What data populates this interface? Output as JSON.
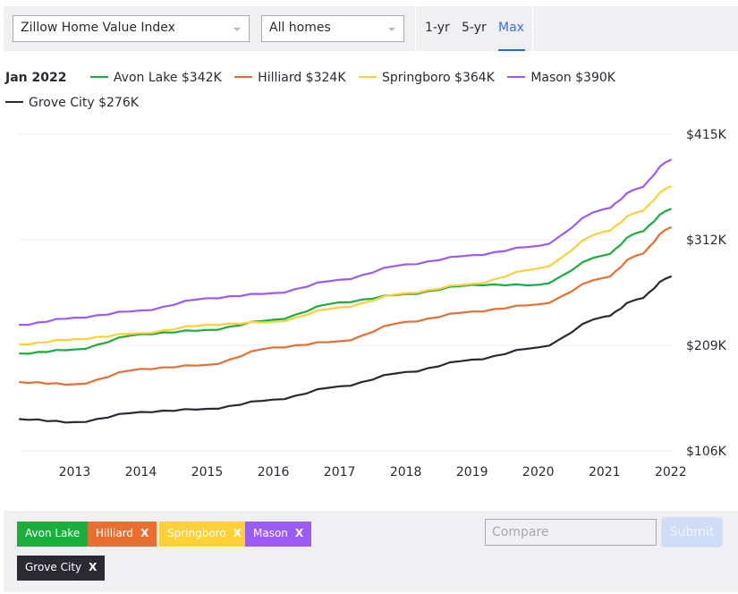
{
  "toolbar": {
    "metric_select": "Zillow Home Value Index",
    "home_type_select": "All homes",
    "ranges": [
      "1-yr",
      "5-yr",
      "Max"
    ],
    "active_range": "Max"
  },
  "legend": {
    "date": "Jan 2022",
    "items": [
      {
        "label": "Avon Lake $342K",
        "color": "#1aae3c"
      },
      {
        "label": "Hilliard $324K",
        "color": "#e86f30"
      },
      {
        "label": "Springboro $364K",
        "color": "#fdd038"
      },
      {
        "label": "Mason $390K",
        "color": "#9b5cf5"
      },
      {
        "label": "Grove City $276K",
        "color": "#2a2a33"
      }
    ]
  },
  "chips": [
    {
      "label": "Avon Lake",
      "removable": false,
      "color": "#1aae3c",
      "text_color": "#ffffff"
    },
    {
      "label": "Hilliard",
      "removable": true,
      "color": "#e86f30",
      "text_color": "#ffffff"
    },
    {
      "label": "Springboro",
      "removable": true,
      "color": "#fdd038",
      "text_color": "#ffffff"
    },
    {
      "label": "Mason",
      "removable": true,
      "color": "#9b5cf5",
      "text_color": "#ffffff"
    },
    {
      "label": "Grove City",
      "removable": true,
      "color": "#2a2a33",
      "text_color": "#ffffff"
    }
  ],
  "chip_remove_label": "X",
  "compare": {
    "placeholder": "Compare",
    "value": ""
  },
  "submit_label": "Submit",
  "chart_data": {
    "type": "line",
    "title": "",
    "xlabel": "",
    "ylabel": "",
    "x_ticks": [
      "2013",
      "2014",
      "2015",
      "2016",
      "2017",
      "2018",
      "2019",
      "2020",
      "2021",
      "2022"
    ],
    "y_ticks": [
      "$106K",
      "$209K",
      "$312K",
      "$415K"
    ],
    "y_tick_values": [
      106,
      209,
      312,
      415
    ],
    "xlim": [
      2012.17,
      2022.07
    ],
    "ylim": [
      106,
      415
    ],
    "grid": true,
    "y_axis_side": "right",
    "units": "thousand USD",
    "x": [
      2012.17,
      2013.0,
      2014.0,
      2015.0,
      2016.0,
      2017.0,
      2018.0,
      2019.0,
      2020.0,
      2021.0,
      2021.5,
      2022.0
    ],
    "series": [
      {
        "name": "Mason",
        "color": "#9b5cf5",
        "values": [
          229,
          236,
          243,
          255,
          260,
          273,
          288,
          297,
          306,
          342,
          362,
          390
        ]
      },
      {
        "name": "Springboro",
        "color": "#fdd038",
        "values": [
          210,
          215,
          221,
          229,
          232,
          246,
          260,
          269,
          284,
          320,
          339,
          364
        ]
      },
      {
        "name": "Avon Lake",
        "color": "#1aae3c",
        "values": [
          201,
          205,
          220,
          224,
          234,
          251,
          259,
          268,
          268,
          297,
          319,
          342
        ]
      },
      {
        "name": "Hilliard",
        "color": "#e86f30",
        "values": [
          173,
          171,
          186,
          190,
          207,
          213,
          232,
          242,
          249,
          275,
          297,
          324
        ]
      },
      {
        "name": "Grove City",
        "color": "#2a2a33",
        "values": [
          137,
          134,
          144,
          147,
          156,
          169,
          183,
          195,
          207,
          237,
          254,
          276
        ]
      }
    ]
  }
}
